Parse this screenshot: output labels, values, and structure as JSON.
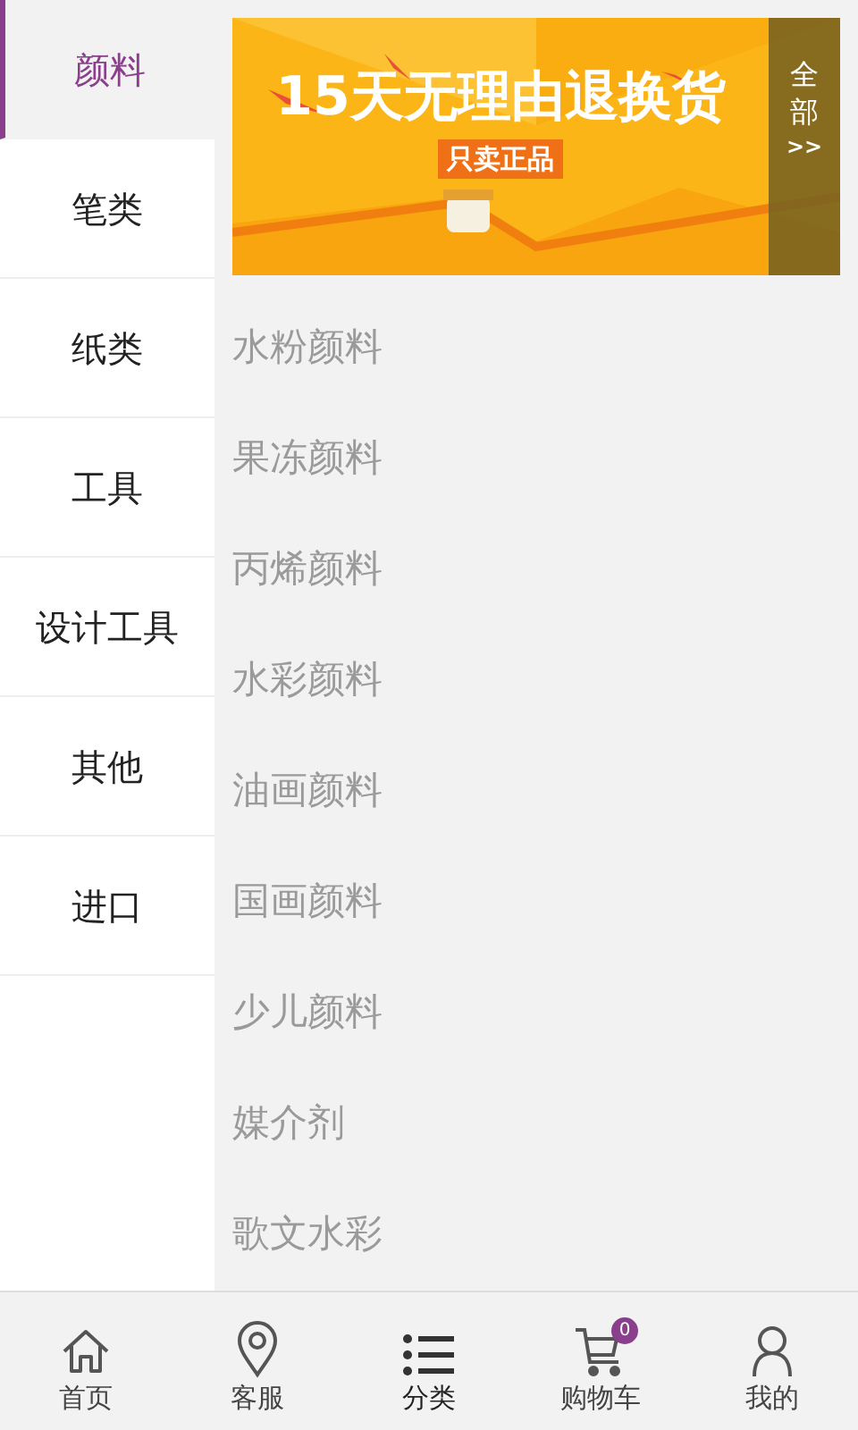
{
  "categories": [
    {
      "label": "颜料",
      "selected": true
    },
    {
      "label": "笔类",
      "selected": false
    },
    {
      "label": "纸类",
      "selected": false
    },
    {
      "label": "工具",
      "selected": false
    },
    {
      "label": "设计工具",
      "selected": false
    },
    {
      "label": "其他",
      "selected": false
    },
    {
      "label": "进口",
      "selected": false
    }
  ],
  "banner": {
    "kind": "picture",
    "headline": "15天无理由退换货",
    "badge": "只卖正品",
    "all_label": "全部",
    "all_arrow": ">>"
  },
  "subcategories": [
    "水粉颜料",
    "果冻颜料",
    "丙烯颜料",
    "水彩颜料",
    "油画颜料",
    "国画颜料",
    "少儿颜料",
    "媒介剂",
    "歌文水彩"
  ],
  "nav": [
    {
      "label": "首页",
      "selected": false
    },
    {
      "label": "客服",
      "selected": false
    },
    {
      "label": "分类",
      "selected": true
    },
    {
      "label": "购物车",
      "selected": false,
      "badge": "0"
    },
    {
      "label": "我的",
      "selected": false
    }
  ]
}
